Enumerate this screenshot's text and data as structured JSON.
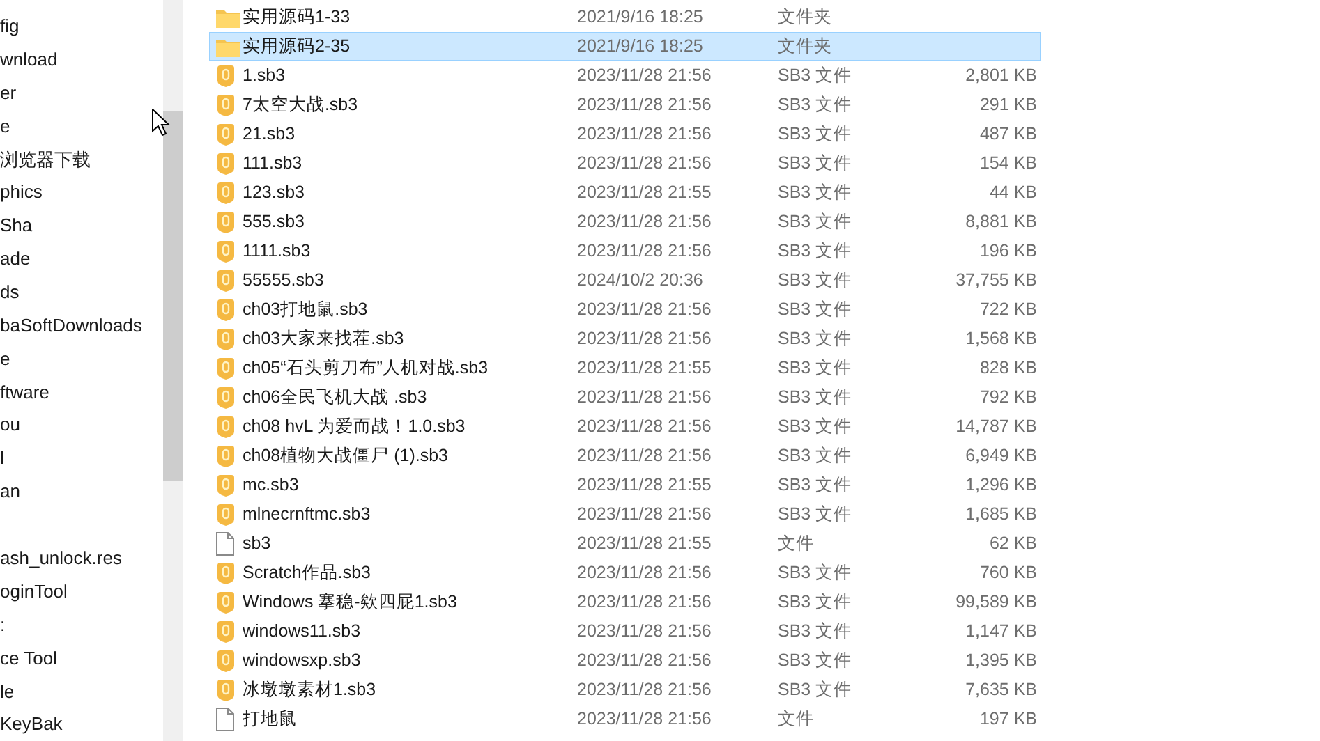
{
  "sidebar": {
    "items": [
      {
        "label": "fig"
      },
      {
        "label": "wnload"
      },
      {
        "label": "er"
      },
      {
        "label": "e"
      },
      {
        "label": "浏览器下载"
      },
      {
        "label": "phics"
      },
      {
        "label": "Sha"
      },
      {
        "label": "ade"
      },
      {
        "label": "ds"
      },
      {
        "label": "baSoftDownloads"
      },
      {
        "label": "e"
      },
      {
        "label": "ftware"
      },
      {
        "label": "ou"
      },
      {
        "label": "l"
      },
      {
        "label": "an"
      },
      {
        "label": "ash_unlock.res",
        "group_start": true
      },
      {
        "label": "oginTool"
      },
      {
        "label": ":"
      },
      {
        "label": "ce Tool"
      },
      {
        "label": "le"
      },
      {
        "label": "KeyBak"
      }
    ]
  },
  "files": [
    {
      "kind": "folder",
      "name": "实用源码1-33",
      "date": "2021/9/16 18:25",
      "type": "文件夹",
      "selected": false
    },
    {
      "kind": "folder",
      "name": "实用源码2-35",
      "date": "2021/9/16 18:25",
      "type": "文件夹",
      "selected": true
    },
    {
      "kind": "sb3",
      "name": "1.sb3",
      "date": "2023/11/28 21:56",
      "type": "SB3 文件",
      "size": "2,801 KB",
      "selected": false
    },
    {
      "kind": "sb3",
      "name": "7太空大战.sb3",
      "date": "2023/11/28 21:56",
      "type": "SB3 文件",
      "size": "291 KB",
      "selected": false
    },
    {
      "kind": "sb3",
      "name": "21.sb3",
      "date": "2023/11/28 21:56",
      "type": "SB3 文件",
      "size": "487 KB",
      "selected": false
    },
    {
      "kind": "sb3",
      "name": "111.sb3",
      "date": "2023/11/28 21:56",
      "type": "SB3 文件",
      "size": "154 KB",
      "selected": false
    },
    {
      "kind": "sb3",
      "name": "123.sb3",
      "date": "2023/11/28 21:55",
      "type": "SB3 文件",
      "size": "44 KB",
      "selected": false
    },
    {
      "kind": "sb3",
      "name": "555.sb3",
      "date": "2023/11/28 21:56",
      "type": "SB3 文件",
      "size": "8,881 KB",
      "selected": false
    },
    {
      "kind": "sb3",
      "name": "1111.sb3",
      "date": "2023/11/28 21:56",
      "type": "SB3 文件",
      "size": "196 KB",
      "selected": false
    },
    {
      "kind": "sb3",
      "name": "55555.sb3",
      "date": "2024/10/2 20:36",
      "type": "SB3 文件",
      "size": "37,755 KB",
      "selected": false
    },
    {
      "kind": "sb3",
      "name": "ch03打地鼠.sb3",
      "date": "2023/11/28 21:56",
      "type": "SB3 文件",
      "size": "722 KB",
      "selected": false
    },
    {
      "kind": "sb3",
      "name": "ch03大家来找茬.sb3",
      "date": "2023/11/28 21:56",
      "type": "SB3 文件",
      "size": "1,568 KB",
      "selected": false
    },
    {
      "kind": "sb3",
      "name": "ch05“石头剪刀布”人机对战.sb3",
      "date": "2023/11/28 21:55",
      "type": "SB3 文件",
      "size": "828 KB",
      "selected": false
    },
    {
      "kind": "sb3",
      "name": "ch06全民飞机大战 .sb3",
      "date": "2023/11/28 21:56",
      "type": "SB3 文件",
      "size": "792 KB",
      "selected": false
    },
    {
      "kind": "sb3",
      "name": "ch08 hvL 为爱而战！1.0.sb3",
      "date": "2023/11/28 21:56",
      "type": "SB3 文件",
      "size": "14,787 KB",
      "selected": false
    },
    {
      "kind": "sb3",
      "name": "ch08植物大战僵尸 (1).sb3",
      "date": "2023/11/28 21:56",
      "type": "SB3 文件",
      "size": "6,949 KB",
      "selected": false
    },
    {
      "kind": "sb3",
      "name": "mc.sb3",
      "date": "2023/11/28 21:55",
      "type": "SB3 文件",
      "size": "1,296 KB",
      "selected": false
    },
    {
      "kind": "sb3",
      "name": "mlnecrnftmc.sb3",
      "date": "2023/11/28 21:56",
      "type": "SB3 文件",
      "size": "1,685 KB",
      "selected": false
    },
    {
      "kind": "file",
      "name": "sb3",
      "date": "2023/11/28 21:55",
      "type": "文件",
      "size": "62 KB",
      "selected": false
    },
    {
      "kind": "sb3",
      "name": "Scratch作品.sb3",
      "date": "2023/11/28 21:56",
      "type": "SB3 文件",
      "size": "760 KB",
      "selected": false
    },
    {
      "kind": "sb3",
      "name": "Windows 搴稳-欸四屁1.sb3",
      "date": "2023/11/28 21:56",
      "type": "SB3 文件",
      "size": "99,589 KB",
      "selected": false
    },
    {
      "kind": "sb3",
      "name": "windows11.sb3",
      "date": "2023/11/28 21:56",
      "type": "SB3 文件",
      "size": "1,147 KB",
      "selected": false
    },
    {
      "kind": "sb3",
      "name": "windowsxp.sb3",
      "date": "2023/11/28 21:56",
      "type": "SB3 文件",
      "size": "1,395 KB",
      "selected": false
    },
    {
      "kind": "sb3",
      "name": "冰墩墩素材1.sb3",
      "date": "2023/11/28 21:56",
      "type": "SB3 文件",
      "size": "7,635 KB",
      "selected": false
    },
    {
      "kind": "file",
      "name": "打地鼠",
      "date": "2023/11/28 21:56",
      "type": "文件",
      "size": "197 KB",
      "selected": false
    }
  ]
}
